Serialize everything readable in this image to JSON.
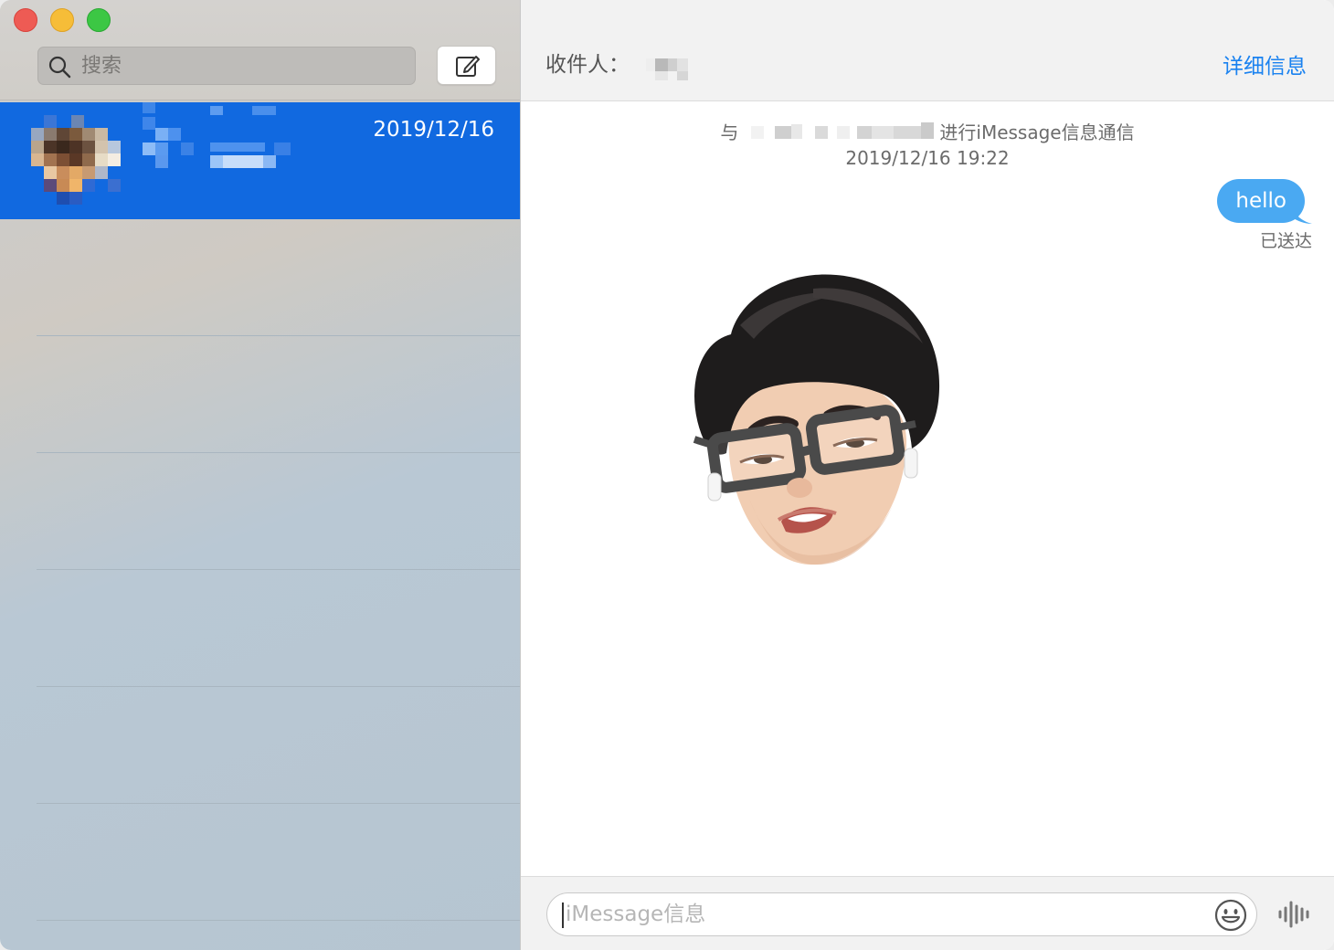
{
  "sidebar": {
    "search": {
      "placeholder": "搜索"
    },
    "compose_icon": "compose-icon",
    "conversations": [
      {
        "date": "2019/12/16",
        "selected": true
      }
    ]
  },
  "header": {
    "to_label": "收件人：",
    "details_label": "详细信息"
  },
  "thread": {
    "info_prefix": "与",
    "info_suffix": "进行iMessage信息通信",
    "info_timestamp": "2019/12/16 19:22",
    "messages": [
      {
        "text": "hello",
        "from_me": true,
        "status": "已送达"
      }
    ]
  },
  "composer": {
    "placeholder": "iMessage信息",
    "emoji_icon": "emoji-icon",
    "audio_icon": "audio-waveform-icon"
  },
  "colors": {
    "accent": "#1169e0",
    "bubble": "#4aa9f2",
    "link": "#1a82f0"
  }
}
